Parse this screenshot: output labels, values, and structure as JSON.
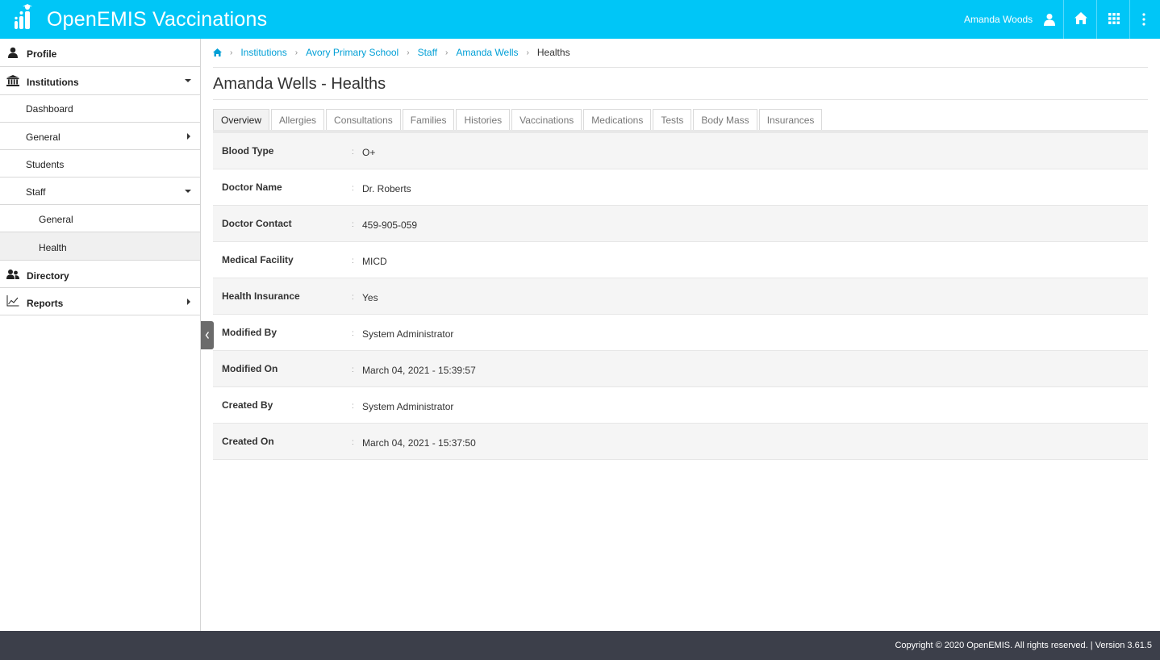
{
  "header": {
    "app_title": "OpenEMIS Vaccinations",
    "user_name": "Amanda Woods"
  },
  "sidebar": {
    "items": [
      {
        "label": "Profile",
        "icon": "user-icon"
      },
      {
        "label": "Institutions",
        "icon": "institution-icon"
      },
      {
        "label": "Dashboard"
      },
      {
        "label": "General"
      },
      {
        "label": "Students"
      },
      {
        "label": "Staff"
      },
      {
        "label": "General"
      },
      {
        "label": "Health"
      },
      {
        "label": "Directory",
        "icon": "directory-icon"
      },
      {
        "label": "Reports",
        "icon": "reports-icon"
      }
    ]
  },
  "breadcrumb": {
    "items": [
      "Institutions",
      "Avory Primary School",
      "Staff",
      "Amanda Wells"
    ],
    "current": "Healths"
  },
  "page": {
    "title": "Amanda Wells - Healths"
  },
  "tabs": [
    "Overview",
    "Allergies",
    "Consultations",
    "Families",
    "Histories",
    "Vaccinations",
    "Medications",
    "Tests",
    "Body Mass",
    "Insurances"
  ],
  "details": [
    {
      "label": "Blood Type",
      "value": "O+"
    },
    {
      "label": "Doctor Name",
      "value": "Dr. Roberts"
    },
    {
      "label": "Doctor Contact",
      "value": "459-905-059"
    },
    {
      "label": "Medical Facility",
      "value": "MICD"
    },
    {
      "label": "Health Insurance",
      "value": "Yes"
    },
    {
      "label": "Modified By",
      "value": "System Administrator"
    },
    {
      "label": "Modified On",
      "value": "March 04, 2021 - 15:39:57"
    },
    {
      "label": "Created By",
      "value": "System Administrator"
    },
    {
      "label": "Created On",
      "value": "March 04, 2021 - 15:37:50"
    }
  ],
  "footer": {
    "text": "Copyright © 2020 OpenEMIS. All rights reserved. | Version 3.61.5"
  },
  "colors": {
    "header_bg": "#00c6f7",
    "link": "#009fd6",
    "footer_bg": "#3c3f4a"
  }
}
